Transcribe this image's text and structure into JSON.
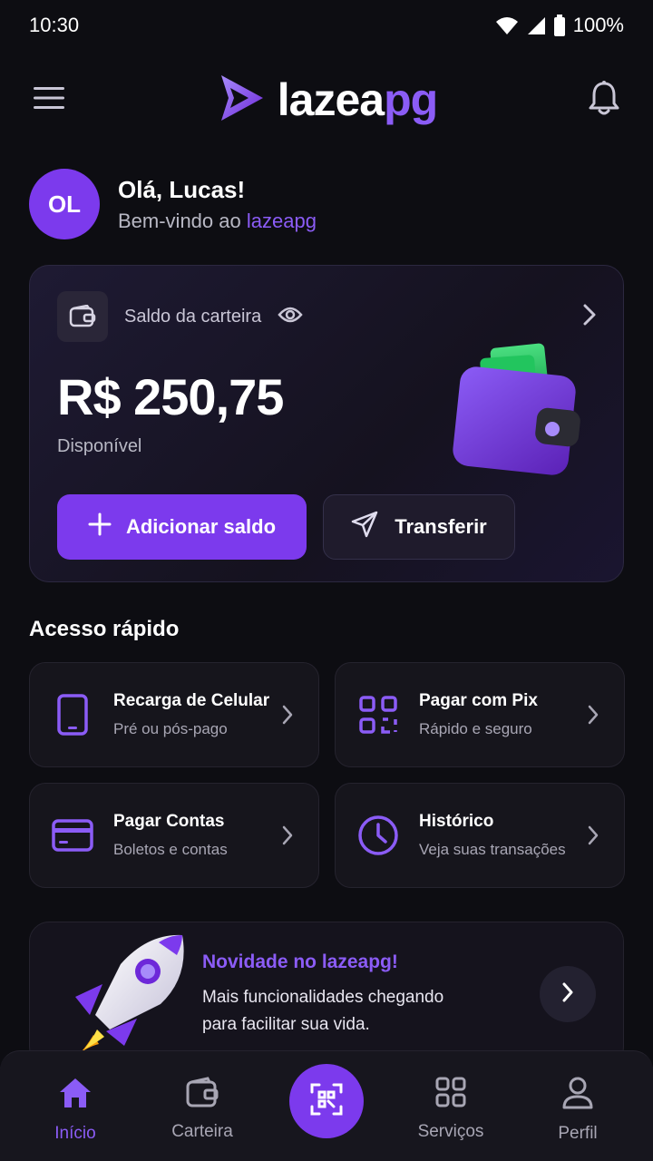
{
  "status_bar": {
    "time": "10:30",
    "battery": "100%"
  },
  "header": {
    "brand_part1": "lazea",
    "brand_part2": "pg"
  },
  "greeting": {
    "initials": "OL",
    "title": "Olá, Lucas!",
    "subtitle_prefix": "Bem-vindo ao ",
    "subtitle_brand": "lazeapg"
  },
  "wallet": {
    "label": "Saldo da carteira",
    "balance": "R$ 250,75",
    "status": "Disponível",
    "add_label": "Adicionar saldo",
    "transfer_label": "Transferir"
  },
  "quick_access": {
    "title": "Acesso rápido",
    "items": [
      {
        "title": "Recarga de Celular",
        "subtitle": "Pré ou pós-pago",
        "icon": "phone-icon"
      },
      {
        "title": "Pagar com Pix",
        "subtitle": "Rápido e seguro",
        "icon": "qr-code-icon"
      },
      {
        "title": "Pagar Contas",
        "subtitle": "Boletos e contas",
        "icon": "credit-card-icon"
      },
      {
        "title": "Histórico",
        "subtitle": "Veja suas transações",
        "icon": "clock-icon"
      }
    ]
  },
  "promo": {
    "title": "Novidade no lazeapg!",
    "text": "Mais funcionalidades chegando para facilitar sua vida."
  },
  "bottom_nav": {
    "items": [
      {
        "label": "Início",
        "icon": "home-icon",
        "active": true
      },
      {
        "label": "Carteira",
        "icon": "wallet-icon",
        "active": false
      },
      {
        "label": "Serviços",
        "icon": "grid-icon",
        "active": false
      },
      {
        "label": "Perfil",
        "icon": "user-icon",
        "active": false
      }
    ],
    "center_icon": "scan-icon"
  },
  "colors": {
    "accent": "#7c3aed",
    "accent_text": "#8b5cf6",
    "background": "#0d0d12"
  }
}
